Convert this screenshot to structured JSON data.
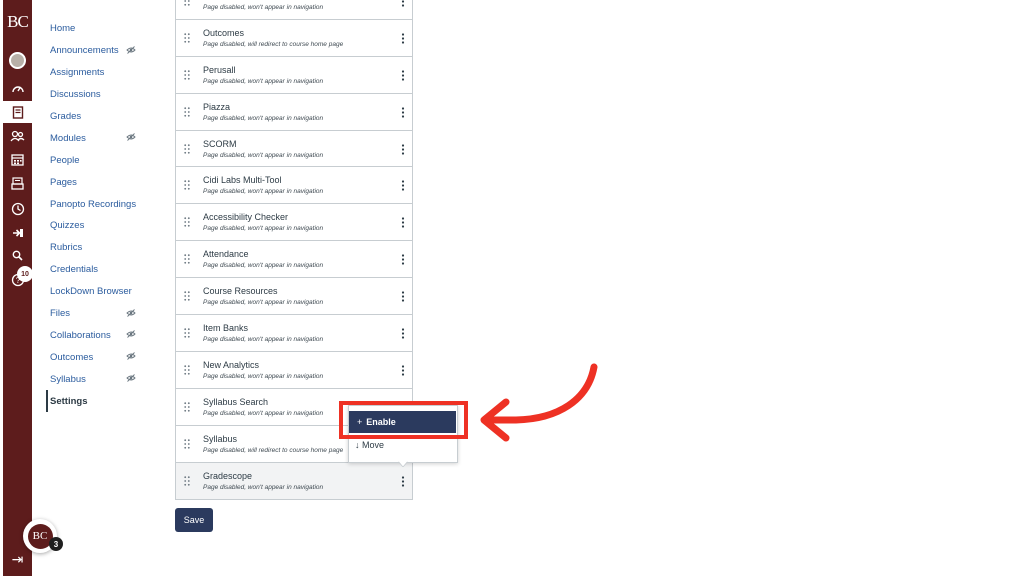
{
  "global_nav": {
    "logo": "BC",
    "badge_count": "10",
    "footer_logo": "BC",
    "footer_badge": "3",
    "icons": [
      "account-avatar-icon",
      "dashboard-icon",
      "courses-icon",
      "groups-icon",
      "calendar-icon",
      "inbox-icon",
      "history-icon",
      "commons-icon",
      "search-icon",
      "help-icon",
      "collapse-nav-icon"
    ]
  },
  "course_nav": {
    "items": [
      {
        "label": "Home",
        "hidden": false
      },
      {
        "label": "Announcements",
        "hidden": true
      },
      {
        "label": "Assignments",
        "hidden": false
      },
      {
        "label": "Discussions",
        "hidden": false
      },
      {
        "label": "Grades",
        "hidden": false
      },
      {
        "label": "Modules",
        "hidden": true
      },
      {
        "label": "People",
        "hidden": false
      },
      {
        "label": "Pages",
        "hidden": false
      },
      {
        "label": "Panopto Recordings",
        "hidden": false
      },
      {
        "label": "Quizzes",
        "hidden": false
      },
      {
        "label": "Rubrics",
        "hidden": false
      },
      {
        "label": "Credentials",
        "hidden": false
      },
      {
        "label": "LockDown Browser",
        "hidden": false
      },
      {
        "label": "Files",
        "hidden": true
      },
      {
        "label": "Collaborations",
        "hidden": true
      },
      {
        "label": "Outcomes",
        "hidden": true
      },
      {
        "label": "Syllabus",
        "hidden": true
      },
      {
        "label": "Settings",
        "hidden": false,
        "active": true
      }
    ]
  },
  "disabled_list": {
    "rows": [
      {
        "title": "",
        "sub": "Page disabled, won't appear in navigation"
      },
      {
        "title": "Outcomes",
        "sub": "Page disabled, will redirect to course home page"
      },
      {
        "title": "Perusall",
        "sub": "Page disabled, won't appear in navigation"
      },
      {
        "title": "Piazza",
        "sub": "Page disabled, won't appear in navigation"
      },
      {
        "title": "SCORM",
        "sub": "Page disabled, won't appear in navigation"
      },
      {
        "title": "Cidi Labs Multi-Tool",
        "sub": "Page disabled, won't appear in navigation"
      },
      {
        "title": "Accessibility Checker",
        "sub": "Page disabled, won't appear in navigation"
      },
      {
        "title": "Attendance",
        "sub": "Page disabled, won't appear in navigation"
      },
      {
        "title": "Course Resources",
        "sub": "Page disabled, won't appear in navigation"
      },
      {
        "title": "Item Banks",
        "sub": "Page disabled, won't appear in navigation"
      },
      {
        "title": "New Analytics",
        "sub": "Page disabled, won't appear in navigation"
      },
      {
        "title": "Syllabus Search",
        "sub": "Page disabled, won't appear in navigation"
      },
      {
        "title": "Syllabus",
        "sub": "Page disabled, will redirect to course home page"
      },
      {
        "title": "Gradescope",
        "sub": "Page disabled, won't appear in navigation",
        "highlighted": true
      }
    ]
  },
  "save_label": "Save",
  "menu": {
    "enable_label": "Enable",
    "move_label": "Move"
  },
  "colors": {
    "brand": "#5d1c1c",
    "link": "#2b5c9e",
    "button": "#2b3a5e",
    "callout": "#ee3124"
  }
}
